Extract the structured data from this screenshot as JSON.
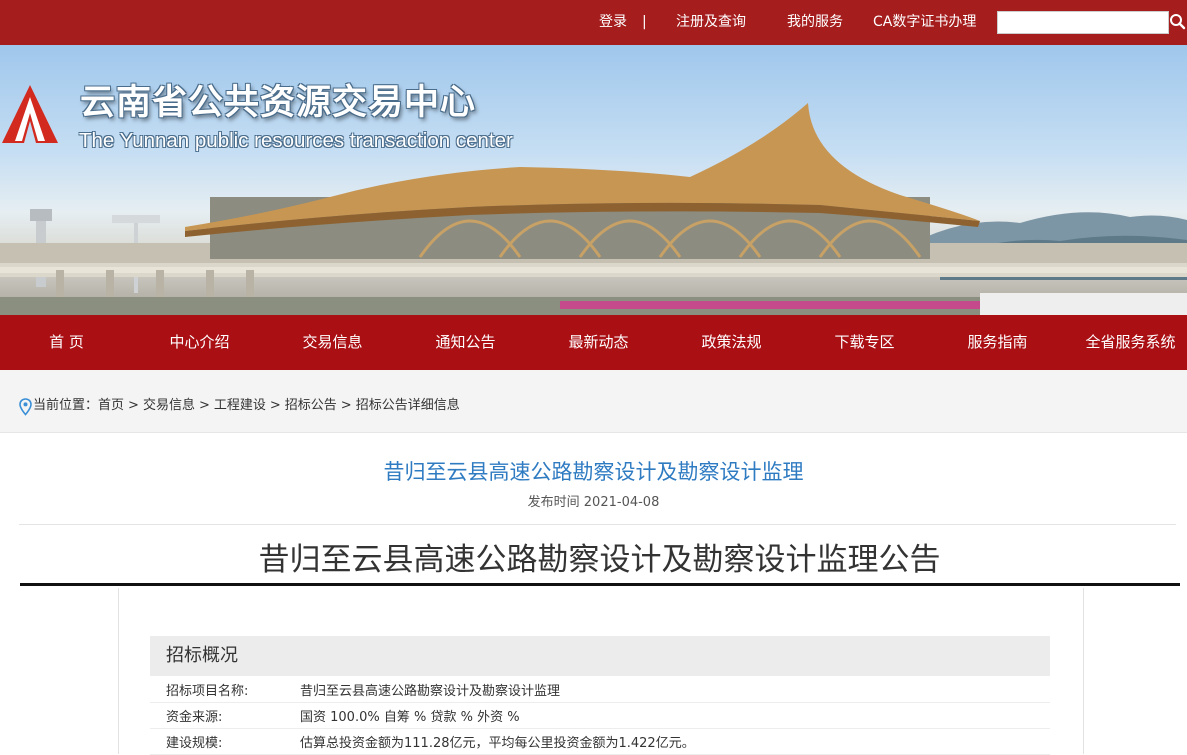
{
  "topbar": {
    "login": "登录",
    "separator": "|",
    "register": "注册及查询",
    "my_service": "我的服务",
    "ca": "CA数字证书办理",
    "search_placeholder": ""
  },
  "banner": {
    "title_cn": "云南省公共资源交易中心",
    "title_en": "The Yunnan public resources transaction center"
  },
  "nav": [
    "首 页",
    "中心介绍",
    "交易信息",
    "通知公告",
    "最新动态",
    "政策法规",
    "下载专区",
    "服务指南",
    "全省服务系统"
  ],
  "breadcrumb": {
    "label": "当前位置：",
    "items": [
      "首页",
      "交易信息",
      "工程建设",
      "招标公告",
      "招标公告详细信息"
    ],
    "sep": ">"
  },
  "article": {
    "title": "昔归至云县高速公路勘察设计及勘察设计监理",
    "publish_time": "发布时间 2021-04-08",
    "announcement_title": "昔归至云县高速公路勘察设计及勘察设计监理公告"
  },
  "overview": {
    "heading": "招标概况",
    "rows": [
      {
        "label": "招标项目名称:",
        "value": "昔归至云县高速公路勘察设计及勘察设计监理"
      },
      {
        "label": "资金来源:",
        "value": "国资 100.0% 自筹 % 贷款 % 外资 %"
      },
      {
        "label": "建设规模:",
        "value": "估算总投资金额为111.28亿元，平均每公里投资金额为1.422亿元。"
      }
    ]
  },
  "colors": {
    "brand_red": "#aa0f14",
    "title_blue": "#2f7bc2"
  },
  "icons": [
    "search-icon",
    "location-pin-icon",
    "logo-icon"
  ]
}
